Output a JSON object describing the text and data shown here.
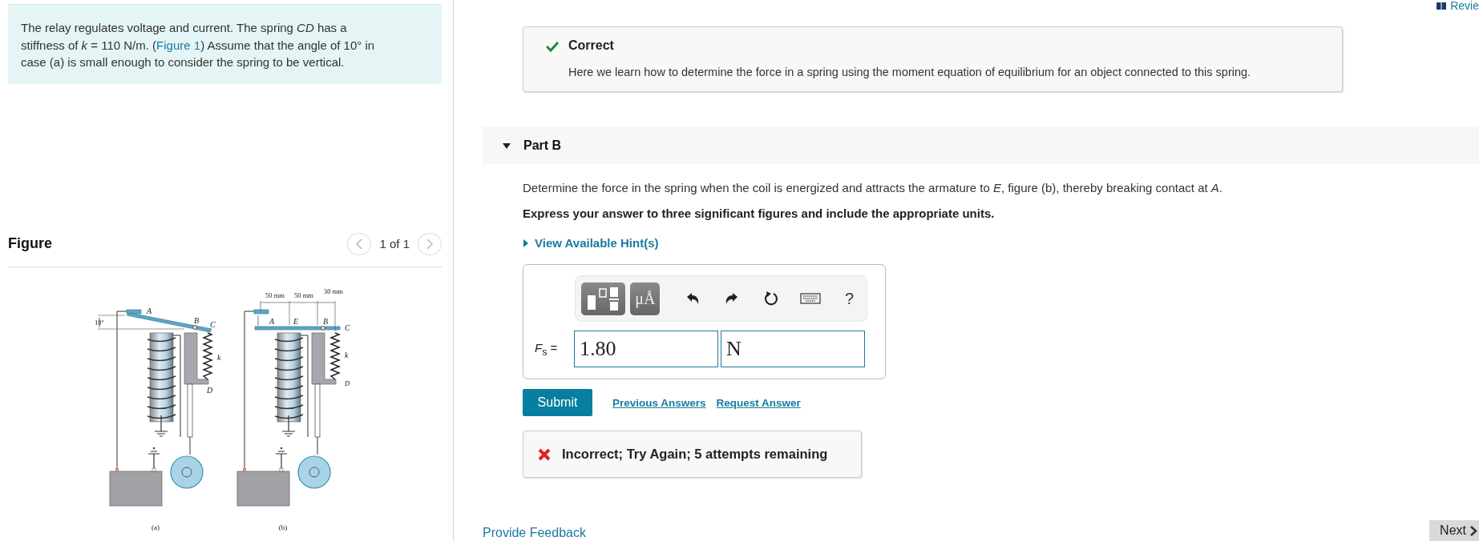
{
  "problem": {
    "text_before": "The relay regulates voltage and current. The spring *CD* has a stiffness of *k* = 110 N/m. (",
    "link": "Figure 1",
    "text_after": ") Assume that the angle of 10° in case (a) is small enough to consider the spring to be vertical."
  },
  "figure": {
    "heading": "Figure",
    "pager": {
      "text": "1 of 1",
      "prev_disabled": true,
      "next_disabled": true
    },
    "diagrams": [
      {
        "kind": "tilted",
        "caption": "(a)",
        "labels": [
          "A",
          "B",
          "C",
          "k",
          "D",
          "10°"
        ]
      },
      {
        "kind": "level",
        "caption": "(b)",
        "labels": [
          "A",
          "E",
          "B",
          "C",
          "k",
          "D",
          "50 mm",
          "50 mm",
          "30 mm"
        ]
      }
    ]
  },
  "review_link": "Revie",
  "feedback_correct": {
    "title": "Correct",
    "message": "Here we learn how to determine the force in a spring using the moment equation of equilibrium for an object connected to this spring."
  },
  "part": {
    "title": "Part B",
    "expanded": true,
    "question": "Determine the force in the spring when the coil is energized and attracts the armature to *E*, figure (b), thereby breaking contact at *A*.",
    "instruction": "Express your answer to three significant figures and include the appropriate units.",
    "hint": {
      "label": "View Available Hint(s)",
      "expanded": false
    },
    "toolbar": {
      "units_button": "μÅ",
      "help": "?"
    },
    "answer": {
      "label": "*F*$_{s}$ =",
      "value": "1.80",
      "unit": "N"
    },
    "submit": "Submit",
    "links": [
      "Previous Answers",
      "Request Answer"
    ],
    "feedback_incorrect": "Incorrect; Try Again; 5 attempts remaining"
  },
  "provide_feedback": "Provide Feedback",
  "next_button": "Next"
}
